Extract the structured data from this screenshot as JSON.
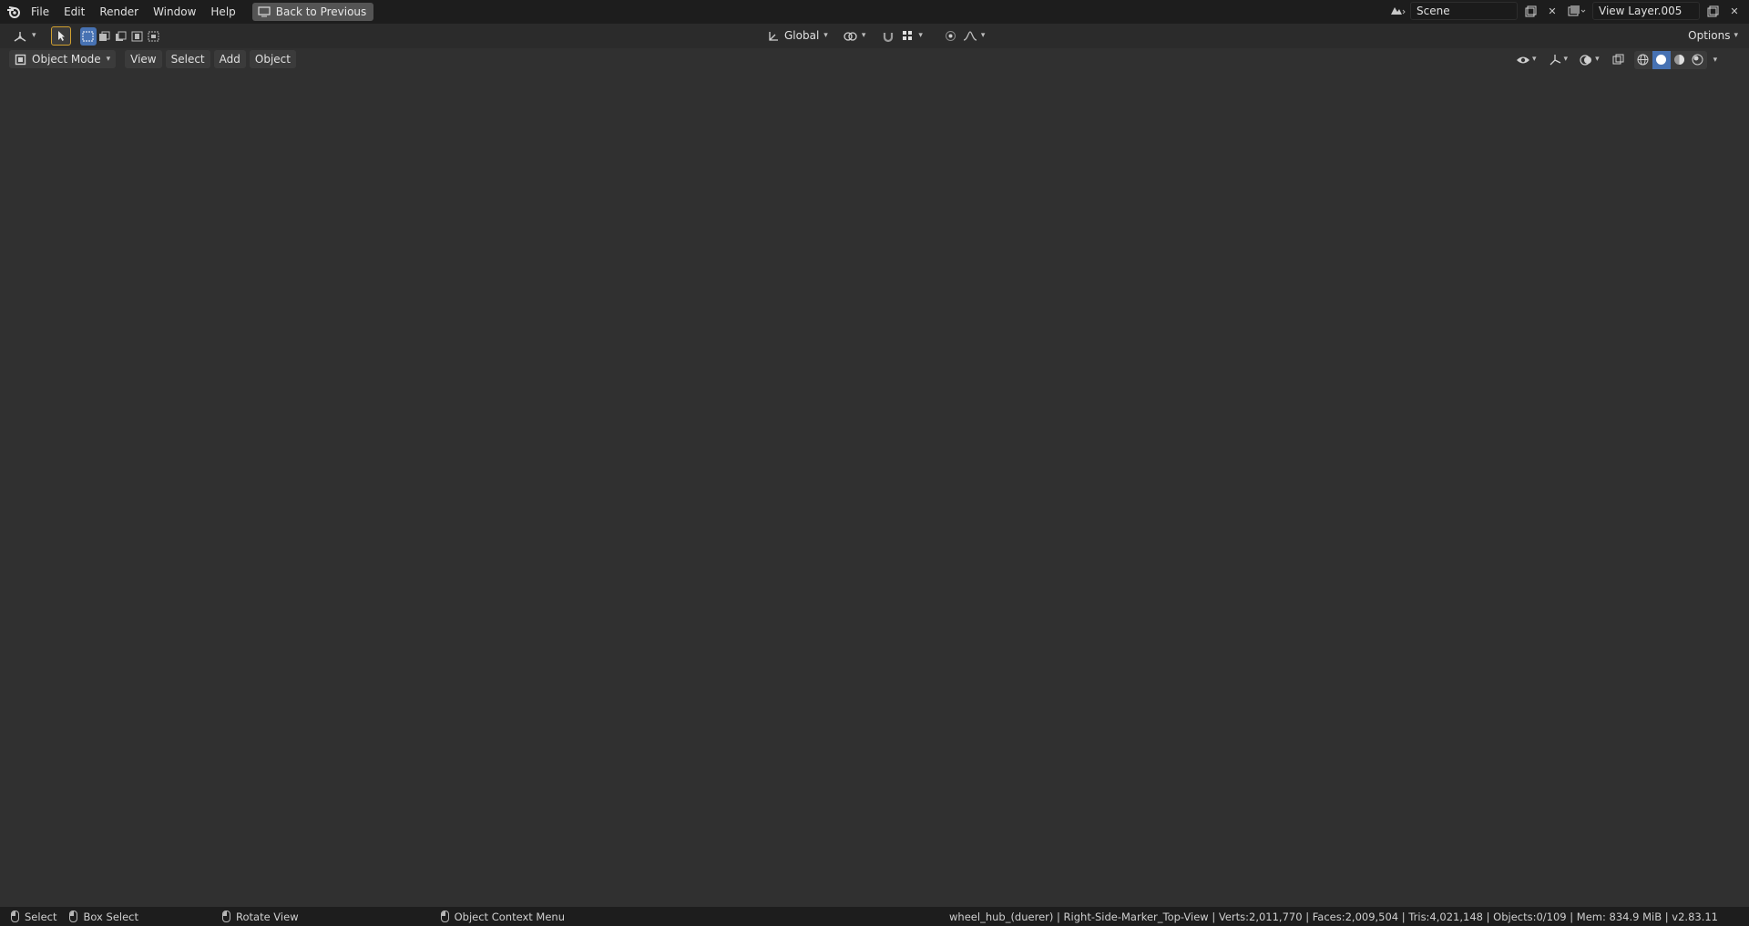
{
  "menu": {
    "items": [
      "File",
      "Edit",
      "Render",
      "Window",
      "Help"
    ],
    "back_button": "Back to Previous"
  },
  "scene": {
    "name": "Scene",
    "view_layer": "View Layer.005"
  },
  "tool_header": {
    "orientation": "Global",
    "options_label": "Options"
  },
  "view_header": {
    "mode": "Object Mode",
    "menus": [
      "View",
      "Select",
      "Add",
      "Object"
    ]
  },
  "status": {
    "select": "Select",
    "box_select": "Box Select",
    "rotate": "Rotate View",
    "context_menu": "Object Context Menu",
    "stats": "wheel_hub_(duerer) | Right-Side-Marker_Top-View | Verts:2,011,770 | Faces:2,009,504 | Tris:4,021,148 | Objects:0/109 | Mem: 834.9 MiB | v2.83.11"
  },
  "colors": {
    "accent": "#4772b3",
    "header": "#1d1d1d",
    "viewport": "#3d3d3d"
  }
}
